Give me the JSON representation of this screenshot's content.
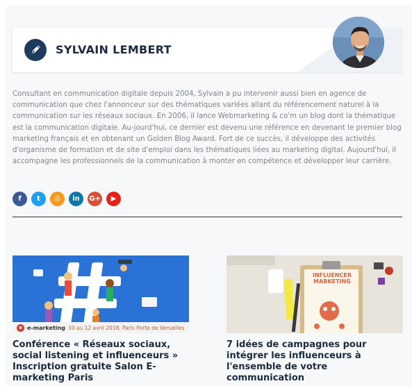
{
  "author": {
    "name": "SYLVAIN LEMBERT",
    "bio": "Consultant en communication digitale depuis 2004, Sylvain a pu intervenir aussi bien en agence de communication que chez l'annonceur sur des thématiques variées allant du référencement naturel à la communication sur les réseaux sociaux. En 2006, il lance Webmarketing & co'm un blog dont la thématique est la communication digitale. Au-jourd'hui, ce dernier est devenu une référence en devenant le premier blog marketing français et en obtenant un Golden Blog Award. Fort de ce succès, il développe des activités d'organisme de formation et de site d'emploi dans les thématiques liées au marketing digital. Aujourd'hui, il accompagne les professionnels de la communication à monter en compétence et développer leur carrière."
  },
  "social": [
    {
      "name": "facebook-icon",
      "glyph": "f",
      "color": "#3b5998"
    },
    {
      "name": "twitter-icon",
      "glyph": "t",
      "color": "#1da1f2"
    },
    {
      "name": "rss-icon",
      "glyph": "◎",
      "color": "#f39a1e"
    },
    {
      "name": "linkedin-icon",
      "glyph": "in",
      "color": "#0e76a8"
    },
    {
      "name": "googleplus-icon",
      "glyph": "G+",
      "color": "#dd4b39"
    },
    {
      "name": "youtube-icon",
      "glyph": "▶",
      "color": "#e62117"
    }
  ],
  "articles": [
    {
      "title": "Conférence « Réseaux sociaux, social listening et influenceurs » Inscription gratuite Salon E-marketing Paris",
      "thumb": {
        "brand": "e-marketing",
        "dates": "10 au 12 avril 2018, Paris Porte de Versailles",
        "bg_color": "#2a72d6"
      }
    },
    {
      "title": "7 idées de campagnes pour intégrer les influenceurs à l'ensemble de votre communication",
      "thumb": {
        "label": "INFLUENCER MARKETING",
        "bg_color": "#e8e4dc"
      }
    }
  ],
  "colors": {
    "heading": "#1c2b3f",
    "body_text": "#808488",
    "accent": "#1e3a5f"
  }
}
